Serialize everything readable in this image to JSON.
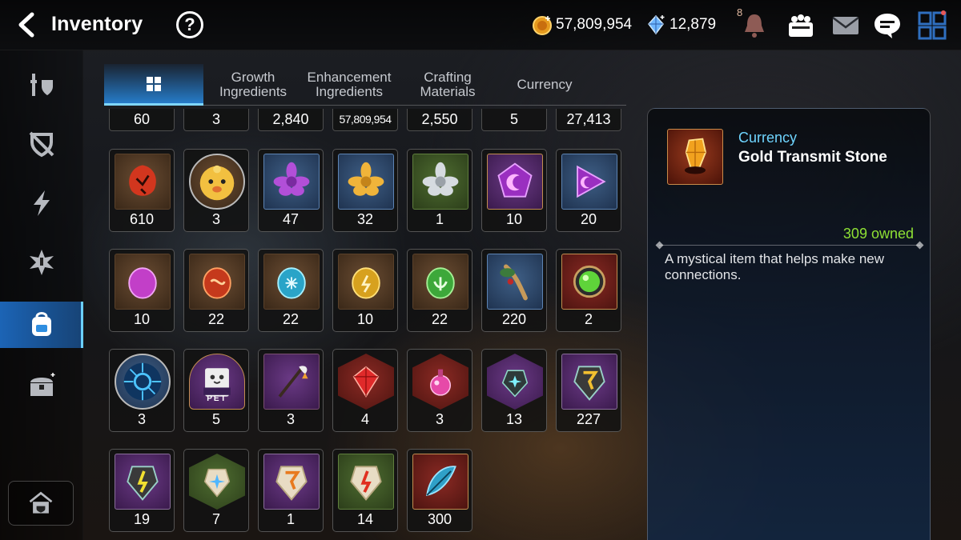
{
  "header": {
    "title": "Inventory",
    "help_label": "?",
    "gold_amount": "57,809,954",
    "crystal_amount": "12,879",
    "notification_count": "8"
  },
  "tabs": [
    {
      "label": "",
      "icon": "grid-icon",
      "active": true
    },
    {
      "label": "Growth\nIngredients",
      "active": false
    },
    {
      "label": "Enhancement\nIngredients",
      "active": false
    },
    {
      "label": "Crafting\nMaterials",
      "active": false
    },
    {
      "label": "Currency",
      "active": false
    }
  ],
  "sidebar": {
    "items": [
      {
        "icon": "gear-equipment-icon",
        "active": false
      },
      {
        "icon": "artifact-shield-icon",
        "active": false
      },
      {
        "icon": "lightning-icon",
        "active": false
      },
      {
        "icon": "catalyst-icon",
        "active": false
      },
      {
        "icon": "backpack-icon",
        "active": true
      },
      {
        "icon": "chest-icon",
        "active": false
      }
    ]
  },
  "grid": {
    "top_counts": [
      "60",
      "3",
      "2,840",
      "57,809,954",
      "2,550",
      "5",
      "27,413"
    ],
    "rows": [
      [
        "610",
        "3",
        "47",
        "32",
        "1",
        "10",
        "20"
      ],
      [
        "10",
        "22",
        "22",
        "10",
        "22",
        "220",
        "2"
      ],
      [
        "3",
        "5",
        "3",
        "4",
        "3",
        "13",
        "227"
      ],
      [
        "19",
        "7",
        "1",
        "14",
        "300"
      ]
    ],
    "pet_label": "PET"
  },
  "detail": {
    "category": "Currency",
    "name": "Gold Transmit Stone",
    "owned": "309 owned",
    "description": "A mystical item that helps make new connections."
  },
  "colors": {
    "accent_blue": "#2f8ee0",
    "owned_green": "#8ee034",
    "category_cyan": "#6fd5ff"
  }
}
